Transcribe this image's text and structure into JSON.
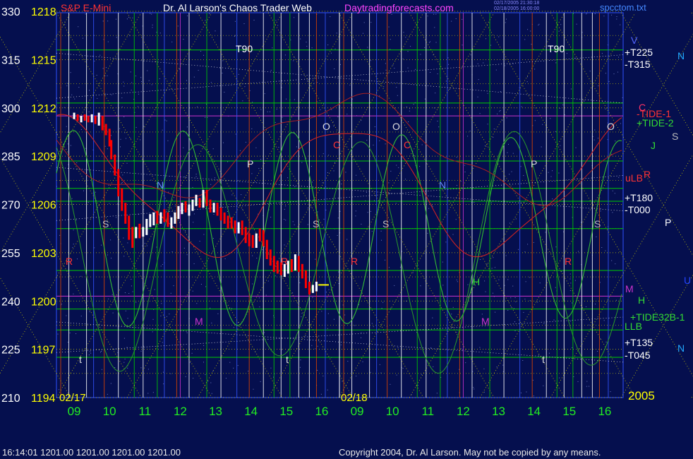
{
  "header": {
    "symbol": "S&P E-Mini",
    "title": "Dr. Al Larson's Chaos Trader Web",
    "site": "Daytradingforecasts.com",
    "stamp_line1": "02/17/2005 21:30:18",
    "stamp_line2": "02/18/2005 16:00:00",
    "file": "spcctom.txt"
  },
  "status": {
    "quote": "16:14:01  1201.00 1201.00 1201.00 1201.00",
    "copyright": "Copyright 2004, Dr. Al Larson. May not be copied by any means."
  },
  "colors": {
    "background": "#050f4e",
    "price_bar": "#ff0000",
    "price_bar_up": "#ffffff",
    "flux_line": "#33bb33",
    "tide_line": "#cc2222",
    "hour_grid": "#ffffff",
    "quad_grid": "#c8c800",
    "planet_line": "#00cc00",
    "vertical_blue": "#3355ff",
    "vertical_magenta": "#cc33cc",
    "vertical_orange": "#dd4400"
  },
  "chart_data": {
    "type": "bar",
    "title": "S&P E-Mini",
    "y_left_degrees": [
      "330",
      "315",
      "300",
      "285",
      "270",
      "255",
      "240",
      "225",
      "210"
    ],
    "y_left_prices": [
      "1218",
      "1215",
      "1212",
      "1209",
      "1206",
      "1203",
      "1200",
      "1197",
      "1194"
    ],
    "ylim": [
      1194,
      1218
    ],
    "x_hours": [
      "09",
      "10",
      "11",
      "12",
      "13",
      "14",
      "15",
      "16",
      "09",
      "10",
      "11",
      "12",
      "13",
      "14",
      "15",
      "16"
    ],
    "x_dates": [
      "02/17",
      "02/18"
    ],
    "year": "2005",
    "ohlc_day1": [
      [
        9.0,
        1211.5,
        1211.7,
        1211.3,
        1211.5
      ],
      [
        9.1,
        1211.5,
        1211.6,
        1211.2,
        1211.3
      ],
      [
        9.2,
        1211.3,
        1211.5,
        1211.1,
        1211.4
      ],
      [
        9.3,
        1211.4,
        1211.6,
        1211.2,
        1211.3
      ],
      [
        9.4,
        1211.3,
        1211.5,
        1211.1,
        1211.2
      ],
      [
        9.5,
        1211.2,
        1211.6,
        1211.1,
        1211.4
      ],
      [
        9.6,
        1211.4,
        1211.5,
        1211.0,
        1211.1
      ],
      [
        9.7,
        1211.1,
        1211.7,
        1210.9,
        1211.3
      ],
      [
        9.8,
        1211.3,
        1211.5,
        1210.6,
        1210.9
      ],
      [
        9.9,
        1210.9,
        1211.0,
        1210.3,
        1210.5
      ],
      [
        10.0,
        1210.5,
        1210.7,
        1209.6,
        1209.8
      ],
      [
        10.05,
        1209.8,
        1210.0,
        1208.8,
        1209.0
      ],
      [
        10.15,
        1209.0,
        1209.1,
        1207.8,
        1208.0
      ],
      [
        10.25,
        1208.0,
        1208.2,
        1206.5,
        1206.8
      ],
      [
        10.35,
        1206.8,
        1207.0,
        1205.6,
        1205.9
      ],
      [
        10.45,
        1205.9,
        1206.1,
        1204.8,
        1205.0
      ],
      [
        10.55,
        1205.0,
        1205.3,
        1203.8,
        1204.2
      ],
      [
        10.65,
        1204.2,
        1204.6,
        1203.3,
        1204.1
      ],
      [
        10.75,
        1204.1,
        1204.6,
        1203.9,
        1204.4
      ],
      [
        10.85,
        1204.4,
        1204.8,
        1203.9,
        1204.2
      ],
      [
        10.95,
        1204.2,
        1204.6,
        1204.0,
        1204.3
      ],
      [
        11.05,
        1204.3,
        1205.1,
        1204.1,
        1204.9
      ],
      [
        11.15,
        1204.9,
        1205.4,
        1204.6,
        1205.0
      ],
      [
        11.25,
        1205.0,
        1205.5,
        1204.7,
        1205.2
      ],
      [
        11.35,
        1205.2,
        1205.6,
        1204.8,
        1205.1
      ],
      [
        11.45,
        1205.1,
        1205.5,
        1204.8,
        1205.3
      ],
      [
        11.55,
        1205.3,
        1205.7,
        1204.9,
        1205.2
      ],
      [
        11.65,
        1205.2,
        1205.5,
        1204.6,
        1204.8
      ],
      [
        11.75,
        1204.8,
        1205.2,
        1204.5,
        1205.0
      ],
      [
        11.85,
        1205.0,
        1205.5,
        1204.8,
        1205.3
      ],
      [
        11.95,
        1205.3,
        1205.9,
        1205.1,
        1205.6
      ],
      [
        12.05,
        1205.6,
        1206.1,
        1205.4,
        1205.9
      ],
      [
        12.15,
        1205.9,
        1206.2,
        1205.5,
        1205.7
      ],
      [
        12.25,
        1205.7,
        1206.0,
        1205.3,
        1205.8
      ],
      [
        12.35,
        1205.8,
        1206.3,
        1205.6,
        1206.1
      ],
      [
        12.45,
        1206.1,
        1206.6,
        1205.9,
        1206.2
      ],
      [
        12.55,
        1206.2,
        1206.4,
        1205.8,
        1206.0
      ],
      [
        12.65,
        1206.0,
        1206.9,
        1205.8,
        1206.6
      ],
      [
        12.75,
        1206.6,
        1206.9,
        1205.9,
        1206.1
      ],
      [
        12.85,
        1206.1,
        1206.3,
        1205.5,
        1205.7
      ],
      [
        12.95,
        1205.7,
        1206.1,
        1205.5,
        1205.8
      ],
      [
        13.05,
        1205.8,
        1206.1,
        1205.3,
        1205.5
      ],
      [
        13.15,
        1205.5,
        1205.8,
        1205.0,
        1205.2
      ],
      [
        13.25,
        1205.2,
        1205.5,
        1204.8,
        1205.0
      ],
      [
        13.35,
        1205.0,
        1205.3,
        1204.5,
        1204.9
      ],
      [
        13.45,
        1204.9,
        1205.2,
        1204.5,
        1204.8
      ],
      [
        13.55,
        1204.8,
        1205.0,
        1204.2,
        1204.4
      ],
      [
        13.65,
        1204.4,
        1204.9,
        1204.2,
        1204.7
      ],
      [
        13.75,
        1204.7,
        1205.0,
        1204.1,
        1204.3
      ],
      [
        13.85,
        1204.3,
        1204.6,
        1203.6,
        1203.9
      ],
      [
        13.95,
        1203.9,
        1204.2,
        1203.4,
        1203.7
      ],
      [
        14.05,
        1203.7,
        1204.1,
        1203.3,
        1203.6
      ],
      [
        14.15,
        1203.6,
        1204.2,
        1203.3,
        1204.0
      ],
      [
        14.25,
        1204.0,
        1204.5,
        1203.7,
        1203.9
      ],
      [
        14.35,
        1203.9,
        1204.4,
        1203.4,
        1203.6
      ],
      [
        14.45,
        1203.6,
        1203.8,
        1202.6,
        1202.9
      ],
      [
        14.55,
        1202.9,
        1203.2,
        1202.2,
        1202.4
      ],
      [
        14.65,
        1202.4,
        1202.8,
        1201.8,
        1202.1
      ],
      [
        14.75,
        1202.1,
        1202.5,
        1201.7,
        1202.0
      ],
      [
        14.85,
        1202.0,
        1202.4,
        1201.6,
        1201.9
      ],
      [
        14.95,
        1201.9,
        1202.3,
        1201.5,
        1202.0
      ],
      [
        15.05,
        1202.0,
        1202.5,
        1201.7,
        1202.2
      ],
      [
        15.15,
        1202.2,
        1202.6,
        1201.8,
        1202.0
      ],
      [
        15.25,
        1202.0,
        1202.9,
        1201.9,
        1202.6
      ],
      [
        15.35,
        1202.6,
        1202.8,
        1201.8,
        1202.0
      ],
      [
        15.45,
        1202.0,
        1202.3,
        1201.4,
        1201.6
      ],
      [
        15.55,
        1201.6,
        1201.9,
        1200.8,
        1201.0
      ],
      [
        15.65,
        1201.0,
        1201.2,
        1200.4,
        1200.6
      ],
      [
        15.75,
        1200.6,
        1201.0,
        1200.5,
        1200.8
      ],
      [
        15.85,
        1200.8,
        1201.2,
        1200.6,
        1201.0
      ]
    ],
    "last_price": 1201.0,
    "tide_left_value": 1205.2,
    "annotations_left": [
      "T90",
      "N",
      "P",
      "O",
      "S",
      "R",
      "M",
      "t",
      "C"
    ],
    "annotations_right": [
      "T90",
      "O",
      "N",
      "P",
      "S",
      "R",
      "H",
      "M",
      "C"
    ],
    "right_labels": [
      {
        "text": "+T225",
        "color": "#ffffff"
      },
      {
        "text": "-T315",
        "color": "#ffffff"
      },
      {
        "text": "-TIDE-1",
        "color": "#ff3333"
      },
      {
        "text": "+TIDE-2",
        "color": "#33dd33"
      },
      {
        "text": "uLB",
        "color": "#ff3333"
      },
      {
        "text": "+T180",
        "color": "#ffffff"
      },
      {
        "text": "-T000",
        "color": "#ffffff"
      },
      {
        "text": "+TIDE32B-1",
        "color": "#33dd33"
      },
      {
        "text": "LLB",
        "color": "#33dd33"
      },
      {
        "text": "+T135",
        "color": "#ffffff"
      },
      {
        "text": "-T045",
        "color": "#ffffff"
      }
    ],
    "planet_glyphs": [
      "V",
      "N",
      "C",
      "S",
      "J",
      "R",
      "P",
      "U",
      "M",
      "H",
      "N"
    ]
  }
}
